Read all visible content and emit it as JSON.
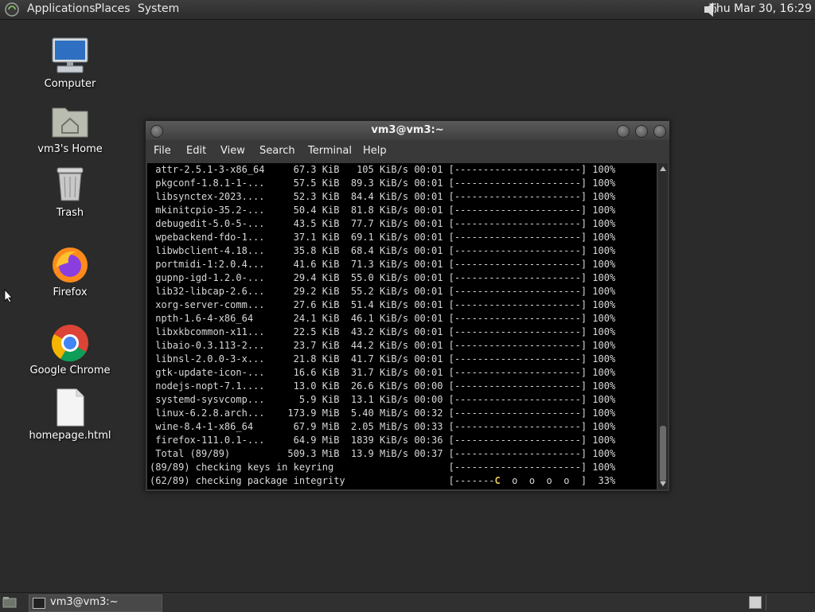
{
  "top_panel": {
    "menus": [
      "Applications",
      "Places",
      "System"
    ],
    "clock": "Thu Mar 30, 16:29"
  },
  "desktop_icons": [
    {
      "label": "Computer",
      "icon": "computer-icon"
    },
    {
      "label": "vm3's Home",
      "icon": "home-folder-icon"
    },
    {
      "label": "Trash",
      "icon": "trash-icon"
    },
    {
      "label": "Firefox",
      "icon": "firefox-icon"
    },
    {
      "label": "Google Chrome",
      "icon": "chrome-icon"
    },
    {
      "label": "homepage.html",
      "icon": "file-icon"
    }
  ],
  "terminal": {
    "title": "vm3@vm3:~",
    "menu": [
      "File",
      "Edit",
      "View",
      "Search",
      "Terminal",
      "Help"
    ],
    "lines": [
      " attr-2.5.1-3-x86_64     67.3 KiB   105 KiB/s 00:01 [----------------------] 100%",
      " pkgconf-1.8.1-1-...     57.5 KiB  89.3 KiB/s 00:01 [----------------------] 100%",
      " libsynctex-2023....     52.3 KiB  84.4 KiB/s 00:01 [----------------------] 100%",
      " mkinitcpio-35.2-...     50.4 KiB  81.8 KiB/s 00:01 [----------------------] 100%",
      " debugedit-5.0-5-...     43.5 KiB  77.7 KiB/s 00:01 [----------------------] 100%",
      " wpebackend-fdo-1...     37.1 KiB  69.1 KiB/s 00:01 [----------------------] 100%",
      " libwbclient-4.18...     35.8 KiB  68.4 KiB/s 00:01 [----------------------] 100%",
      " portmidi-1:2.0.4...     41.6 KiB  71.3 KiB/s 00:01 [----------------------] 100%",
      " gupnp-igd-1.2.0-...     29.4 KiB  55.0 KiB/s 00:01 [----------------------] 100%",
      " lib32-libcap-2.6...     29.2 KiB  55.2 KiB/s 00:01 [----------------------] 100%",
      " xorg-server-comm...     27.6 KiB  51.4 KiB/s 00:01 [----------------------] 100%",
      " npth-1.6-4-x86_64       24.1 KiB  46.1 KiB/s 00:01 [----------------------] 100%",
      " libxkbcommon-x11...     22.5 KiB  43.2 KiB/s 00:01 [----------------------] 100%",
      " libaio-0.3.113-2...     23.7 KiB  44.2 KiB/s 00:01 [----------------------] 100%",
      " libnsl-2.0.0-3-x...     21.8 KiB  41.7 KiB/s 00:01 [----------------------] 100%",
      " gtk-update-icon-...     16.6 KiB  31.7 KiB/s 00:01 [----------------------] 100%",
      " nodejs-nopt-7.1....     13.0 KiB  26.6 KiB/s 00:00 [----------------------] 100%",
      " systemd-sysvcomp...      5.9 KiB  13.1 KiB/s 00:00 [----------------------] 100%",
      " linux-6.2.8.arch...    173.9 MiB  5.40 MiB/s 00:32 [----------------------] 100%",
      " wine-8.4-1-x86_64       67.9 MiB  2.05 MiB/s 00:33 [----------------------] 100%",
      " firefox-111.0.1-...     64.9 MiB  1839 KiB/s 00:36 [----------------------] 100%",
      " Total (89/89)          509.3 MiB  13.9 MiB/s 00:37 [----------------------] 100%",
      "(89/89) checking keys in keyring                    [----------------------] 100%"
    ],
    "last_line_prefix": "(62/89) checking package integrity                  [-------",
    "last_line_pac": "C",
    "last_line_suffix": "  o  o  o  o  ]  33%"
  },
  "bottom_panel": {
    "task_label": "vm3@vm3:~"
  }
}
